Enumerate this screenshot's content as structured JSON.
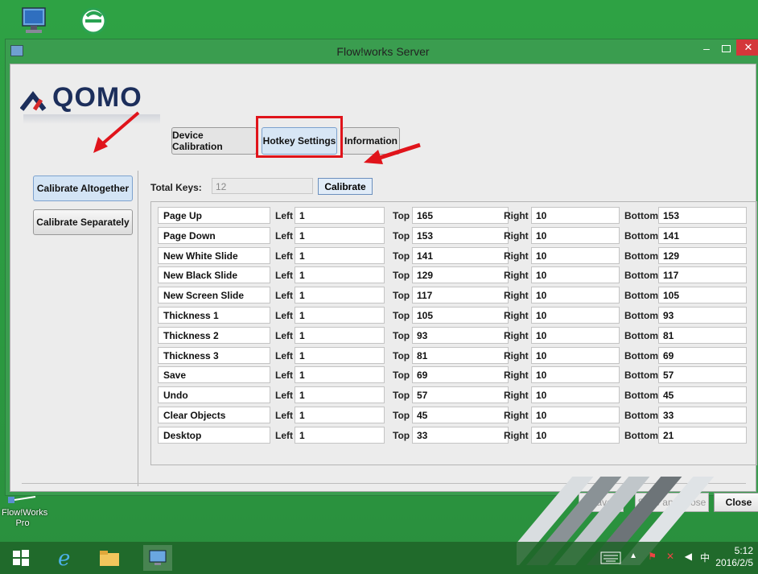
{
  "window": {
    "title": "Flow!works Server",
    "minimize": "–",
    "close": "✕"
  },
  "logo": {
    "text": "QOMO"
  },
  "tabs": [
    {
      "label": "Device Calibration"
    },
    {
      "label": "Hotkey Settings"
    },
    {
      "label": "Information"
    }
  ],
  "left_panel": {
    "calibrate_altogether": "Calibrate Altogether",
    "calibrate_separately": "Calibrate Separately"
  },
  "total_keys": {
    "label": "Total Keys:",
    "value": "12",
    "calibrate": "Calibrate"
  },
  "labels": {
    "left": "Left",
    "top": "Top",
    "right": "Right",
    "bottom": "Bottom"
  },
  "hotkeys": [
    {
      "name": "Page Up",
      "left": "1",
      "top": "165",
      "right": "10",
      "bottom": "153"
    },
    {
      "name": "Page Down",
      "left": "1",
      "top": "153",
      "right": "10",
      "bottom": "141"
    },
    {
      "name": "New White Slide",
      "left": "1",
      "top": "141",
      "right": "10",
      "bottom": "129"
    },
    {
      "name": "New Black Slide",
      "left": "1",
      "top": "129",
      "right": "10",
      "bottom": "117"
    },
    {
      "name": "New Screen Slide",
      "left": "1",
      "top": "117",
      "right": "10",
      "bottom": "105"
    },
    {
      "name": "Thickness 1",
      "left": "1",
      "top": "105",
      "right": "10",
      "bottom": "93"
    },
    {
      "name": "Thickness 2",
      "left": "1",
      "top": "93",
      "right": "10",
      "bottom": "81"
    },
    {
      "name": "Thickness 3",
      "left": "1",
      "top": "81",
      "right": "10",
      "bottom": "69"
    },
    {
      "name": "Save",
      "left": "1",
      "top": "69",
      "right": "10",
      "bottom": "57"
    },
    {
      "name": "Undo",
      "left": "1",
      "top": "57",
      "right": "10",
      "bottom": "45"
    },
    {
      "name": "Clear Objects",
      "left": "1",
      "top": "45",
      "right": "10",
      "bottom": "33"
    },
    {
      "name": "Desktop",
      "left": "1",
      "top": "33",
      "right": "10",
      "bottom": "21"
    }
  ],
  "footer": {
    "save": "Save",
    "save_and_close": "Save and Close",
    "close": "Close"
  },
  "desktop": {
    "flowworks_icon_label": "Flow!Works Pro"
  },
  "taskbar": {
    "time": "5:12",
    "date": "2016/2/5",
    "ime": "中"
  },
  "colors": {
    "highlight_red": "#e0141b",
    "selected_blue": "#d3e4f5",
    "desktop_green": "#2ea244"
  }
}
